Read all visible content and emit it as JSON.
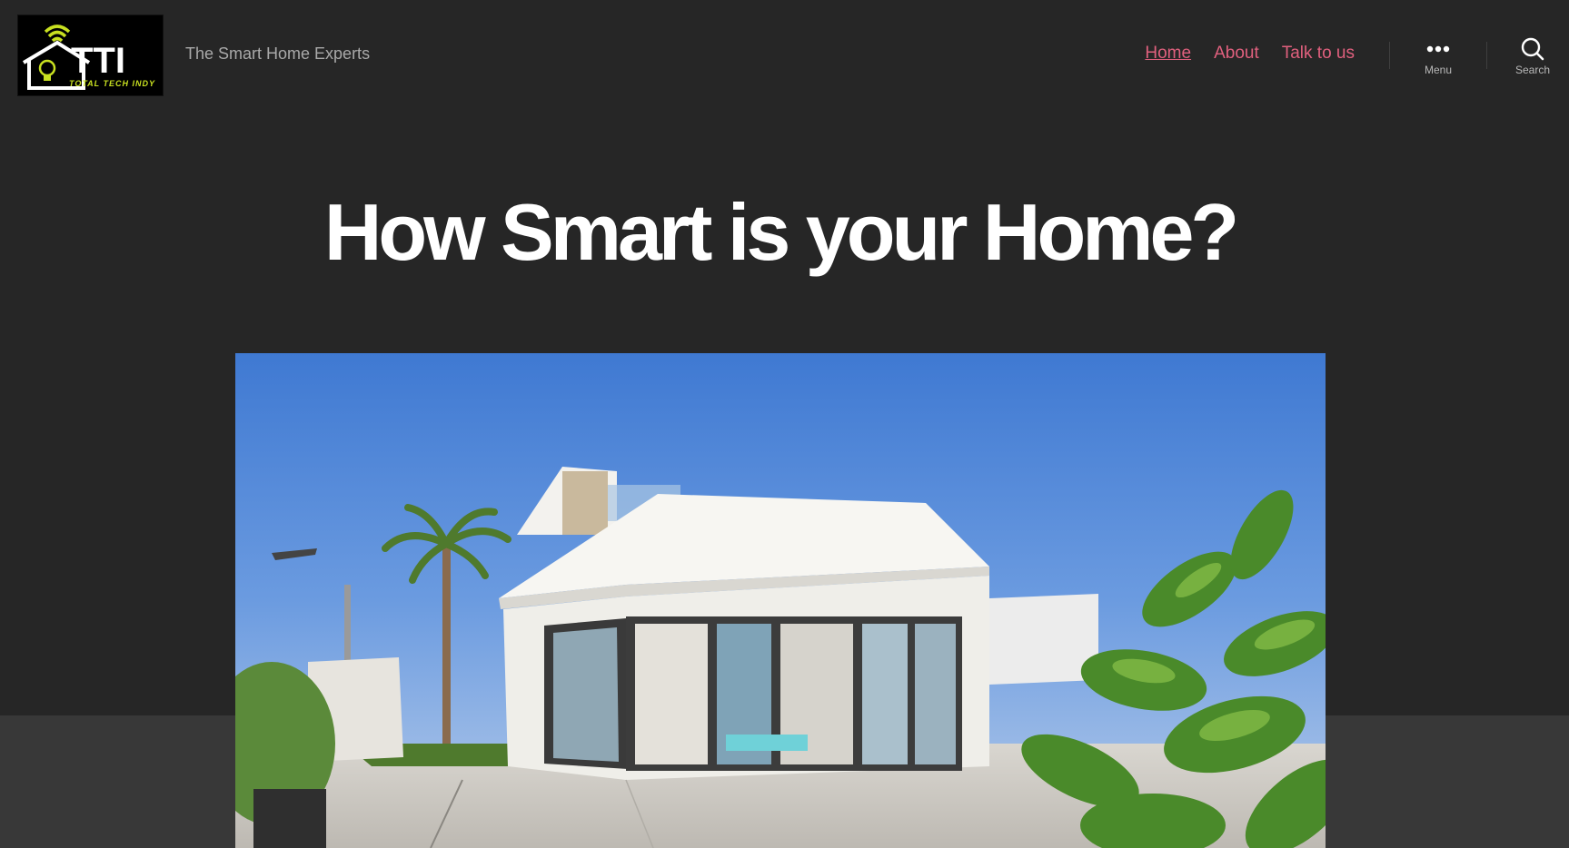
{
  "site": {
    "logo_text": "TTI",
    "logo_subtext": "TOTAL TECH INDY",
    "tagline": "The Smart Home Experts"
  },
  "nav": {
    "items": [
      {
        "label": "Home",
        "current": true
      },
      {
        "label": "About",
        "current": false
      },
      {
        "label": "Talk to us",
        "current": false
      }
    ]
  },
  "toggles": {
    "menu_label": "Menu",
    "search_label": "Search"
  },
  "post": {
    "title": "How Smart is your Home?"
  },
  "icons": {
    "menu": "ellipsis-icon",
    "search": "search-icon",
    "logo": "house-wifi-bulb-icon"
  },
  "colors": {
    "background": "#262626",
    "accent": "#e0607e",
    "logo_accent": "#c8e020"
  }
}
